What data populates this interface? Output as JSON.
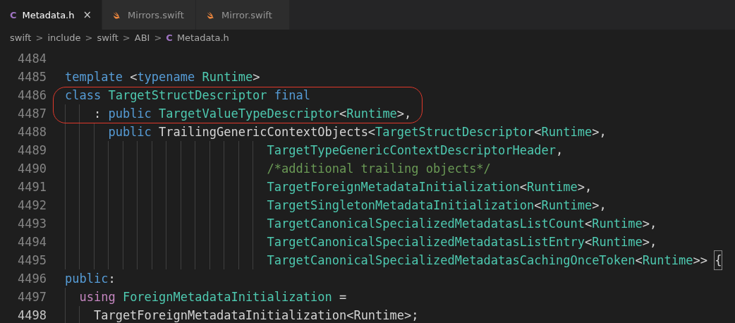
{
  "tabs": [
    {
      "label": "Metadata.h",
      "kind": "c",
      "icon_text": "C",
      "selected": true,
      "close": "×"
    },
    {
      "label": "Mirrors.swift",
      "kind": "swift",
      "selected": false
    },
    {
      "label": "Mirror.swift",
      "kind": "swift",
      "selected": false
    }
  ],
  "breadcrumb": [
    {
      "label": "swift"
    },
    {
      "label": "include"
    },
    {
      "label": "swift"
    },
    {
      "label": "ABI"
    },
    {
      "label": "Metadata.h",
      "kind": "c",
      "icon_text": "C"
    }
  ],
  "breadcrumb_separator": ">",
  "code": [
    {
      "number": "4484",
      "current": false
    },
    {
      "number": "4485",
      "current": false,
      "tokens": [
        {
          "kind": "keyword",
          "text": "template"
        },
        {
          "kind": "plain",
          "text": " <"
        },
        {
          "kind": "keyword",
          "text": "typename"
        },
        {
          "kind": "type",
          "text": " Runtime"
        },
        {
          "kind": "plain",
          "text": ">"
        }
      ]
    },
    {
      "number": "4486",
      "current": false,
      "tokens": [
        {
          "kind": "keyword",
          "text": "class"
        },
        {
          "kind": "type",
          "text": " TargetStructDescriptor"
        },
        {
          "kind": "keyword",
          "text": " final"
        }
      ]
    },
    {
      "number": "4487",
      "current": false,
      "tokens": [
        {
          "kind": "plain",
          "text": "    :"
        },
        {
          "kind": "keyword",
          "text": " public"
        },
        {
          "kind": "type",
          "text": " TargetValueTypeDescriptor"
        },
        {
          "kind": "plain",
          "text": "<"
        },
        {
          "kind": "type",
          "text": "Runtime"
        },
        {
          "kind": "plain",
          "text": ">,"
        }
      ]
    },
    {
      "number": "4488",
      "current": false,
      "tokens": [
        {
          "kind": "keyword",
          "text": "      public"
        },
        {
          "kind": "plain",
          "text": " TrailingGenericContextObjects<"
        },
        {
          "kind": "type",
          "text": "TargetStructDescriptor"
        },
        {
          "kind": "plain",
          "text": "<"
        },
        {
          "kind": "type",
          "text": "Runtime"
        },
        {
          "kind": "plain",
          "text": ">,"
        }
      ]
    },
    {
      "number": "4489",
      "current": false,
      "tokens": [
        {
          "kind": "type",
          "text": "                            TargetTypeGenericContextDescriptorHeader"
        },
        {
          "kind": "plain",
          "text": ","
        }
      ]
    },
    {
      "number": "4490",
      "current": false,
      "tokens": [
        {
          "kind": "comment",
          "text": "                            /*additional trailing objects*/"
        }
      ]
    },
    {
      "number": "4491",
      "current": false,
      "tokens": [
        {
          "kind": "type",
          "text": "                            TargetForeignMetadataInitialization"
        },
        {
          "kind": "plain",
          "text": "<"
        },
        {
          "kind": "type",
          "text": "Runtime"
        },
        {
          "kind": "plain",
          "text": ">,"
        }
      ]
    },
    {
      "number": "4492",
      "current": false,
      "tokens": [
        {
          "kind": "type",
          "text": "                            TargetSingletonMetadataInitialization"
        },
        {
          "kind": "plain",
          "text": "<"
        },
        {
          "kind": "type",
          "text": "Runtime"
        },
        {
          "kind": "plain",
          "text": ">,"
        }
      ]
    },
    {
      "number": "4493",
      "current": false,
      "tokens": [
        {
          "kind": "type",
          "text": "                            TargetCanonicalSpecializedMetadatasListCount"
        },
        {
          "kind": "plain",
          "text": "<"
        },
        {
          "kind": "type",
          "text": "Runtime"
        },
        {
          "kind": "plain",
          "text": ">,"
        }
      ]
    },
    {
      "number": "4494",
      "current": false,
      "tokens": [
        {
          "kind": "type",
          "text": "                            TargetCanonicalSpecializedMetadatasListEntry"
        },
        {
          "kind": "plain",
          "text": "<"
        },
        {
          "kind": "type",
          "text": "Runtime"
        },
        {
          "kind": "plain",
          "text": ">,"
        }
      ]
    },
    {
      "number": "4495",
      "current": false,
      "tokens": [
        {
          "kind": "type",
          "text": "                            TargetCanonicalSpecializedMetadatasCachingOnceToken"
        },
        {
          "kind": "plain",
          "text": "<"
        },
        {
          "kind": "type",
          "text": "Runtime"
        },
        {
          "kind": "plain",
          "text": ">> "
        },
        {
          "kind": "bracket",
          "text": "{"
        }
      ]
    },
    {
      "number": "4496",
      "current": false,
      "tokens": [
        {
          "kind": "keyword",
          "text": "public"
        },
        {
          "kind": "plain",
          "text": ":"
        }
      ]
    },
    {
      "number": "4497",
      "current": false,
      "tokens": [
        {
          "kind": "control",
          "text": "  using"
        },
        {
          "kind": "type",
          "text": " ForeignMetadataInitialization"
        },
        {
          "kind": "plain",
          "text": " ="
        }
      ]
    },
    {
      "number": "4498",
      "current": true,
      "tokens": [
        {
          "kind": "plain",
          "text": "    TargetForeignMetadataInitialization<Runtime>;"
        }
      ]
    }
  ]
}
